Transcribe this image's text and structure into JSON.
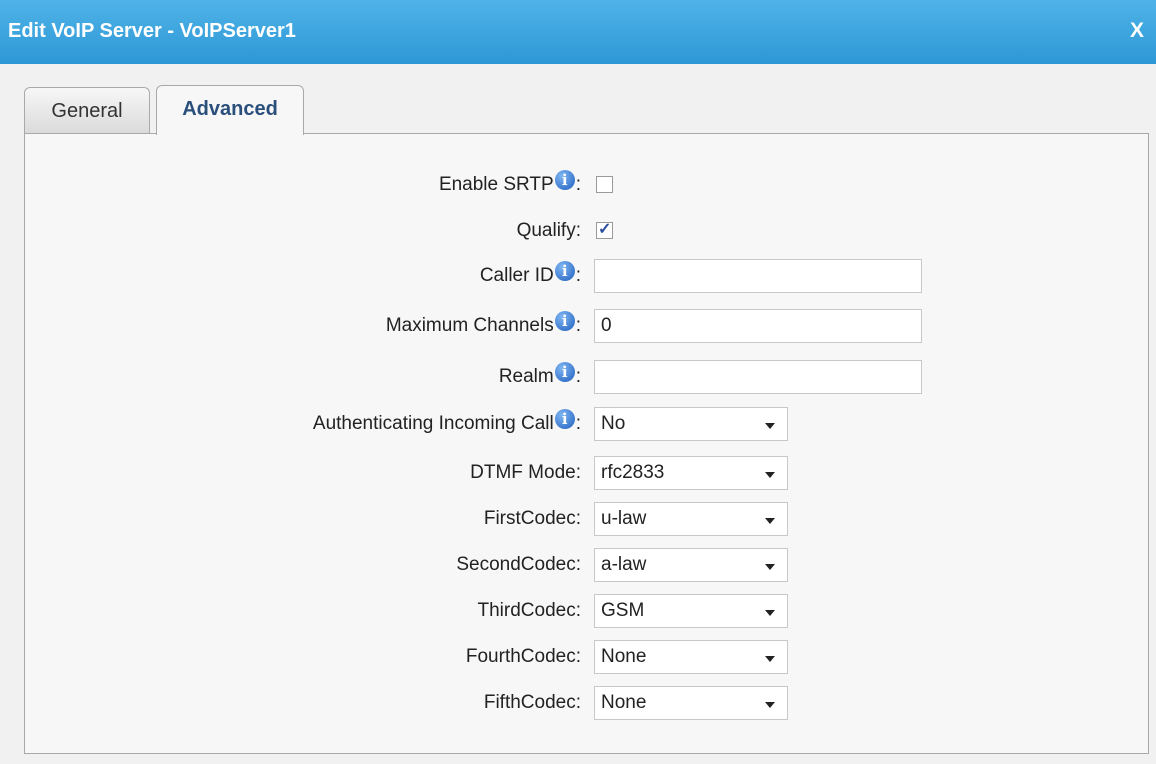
{
  "dialog": {
    "title": "Edit VoIP Server - VoIPServer1",
    "close_label": "X"
  },
  "tabs": [
    {
      "label": "General",
      "active": false
    },
    {
      "label": "Advanced",
      "active": true
    }
  ],
  "fields": {
    "enable_srtp": {
      "label": "Enable SRTP",
      "checked": false
    },
    "qualify": {
      "label": "Qualify:",
      "checked": true
    },
    "caller_id": {
      "label": "Caller ID",
      "value": ""
    },
    "max_channels": {
      "label": "Maximum Channels",
      "value": "0"
    },
    "realm": {
      "label": "Realm",
      "value": ""
    },
    "auth_incoming": {
      "label": "Authenticating Incoming Call",
      "value": "No"
    },
    "dtmf_mode": {
      "label": "DTMF Mode:",
      "value": "rfc2833"
    },
    "first_codec": {
      "label": "FirstCodec:",
      "value": "u-law"
    },
    "second_codec": {
      "label": "SecondCodec:",
      "value": "a-law"
    },
    "third_codec": {
      "label": "ThirdCodec:",
      "value": "GSM"
    },
    "fourth_codec": {
      "label": "FourthCodec:",
      "value": "None"
    },
    "fifth_codec": {
      "label": "FifthCodec:",
      "value": "None"
    }
  },
  "info_glyph": "i",
  "colors": {
    "title_bar": "#2d97d6",
    "active_tab_text": "#2a4f7a"
  }
}
